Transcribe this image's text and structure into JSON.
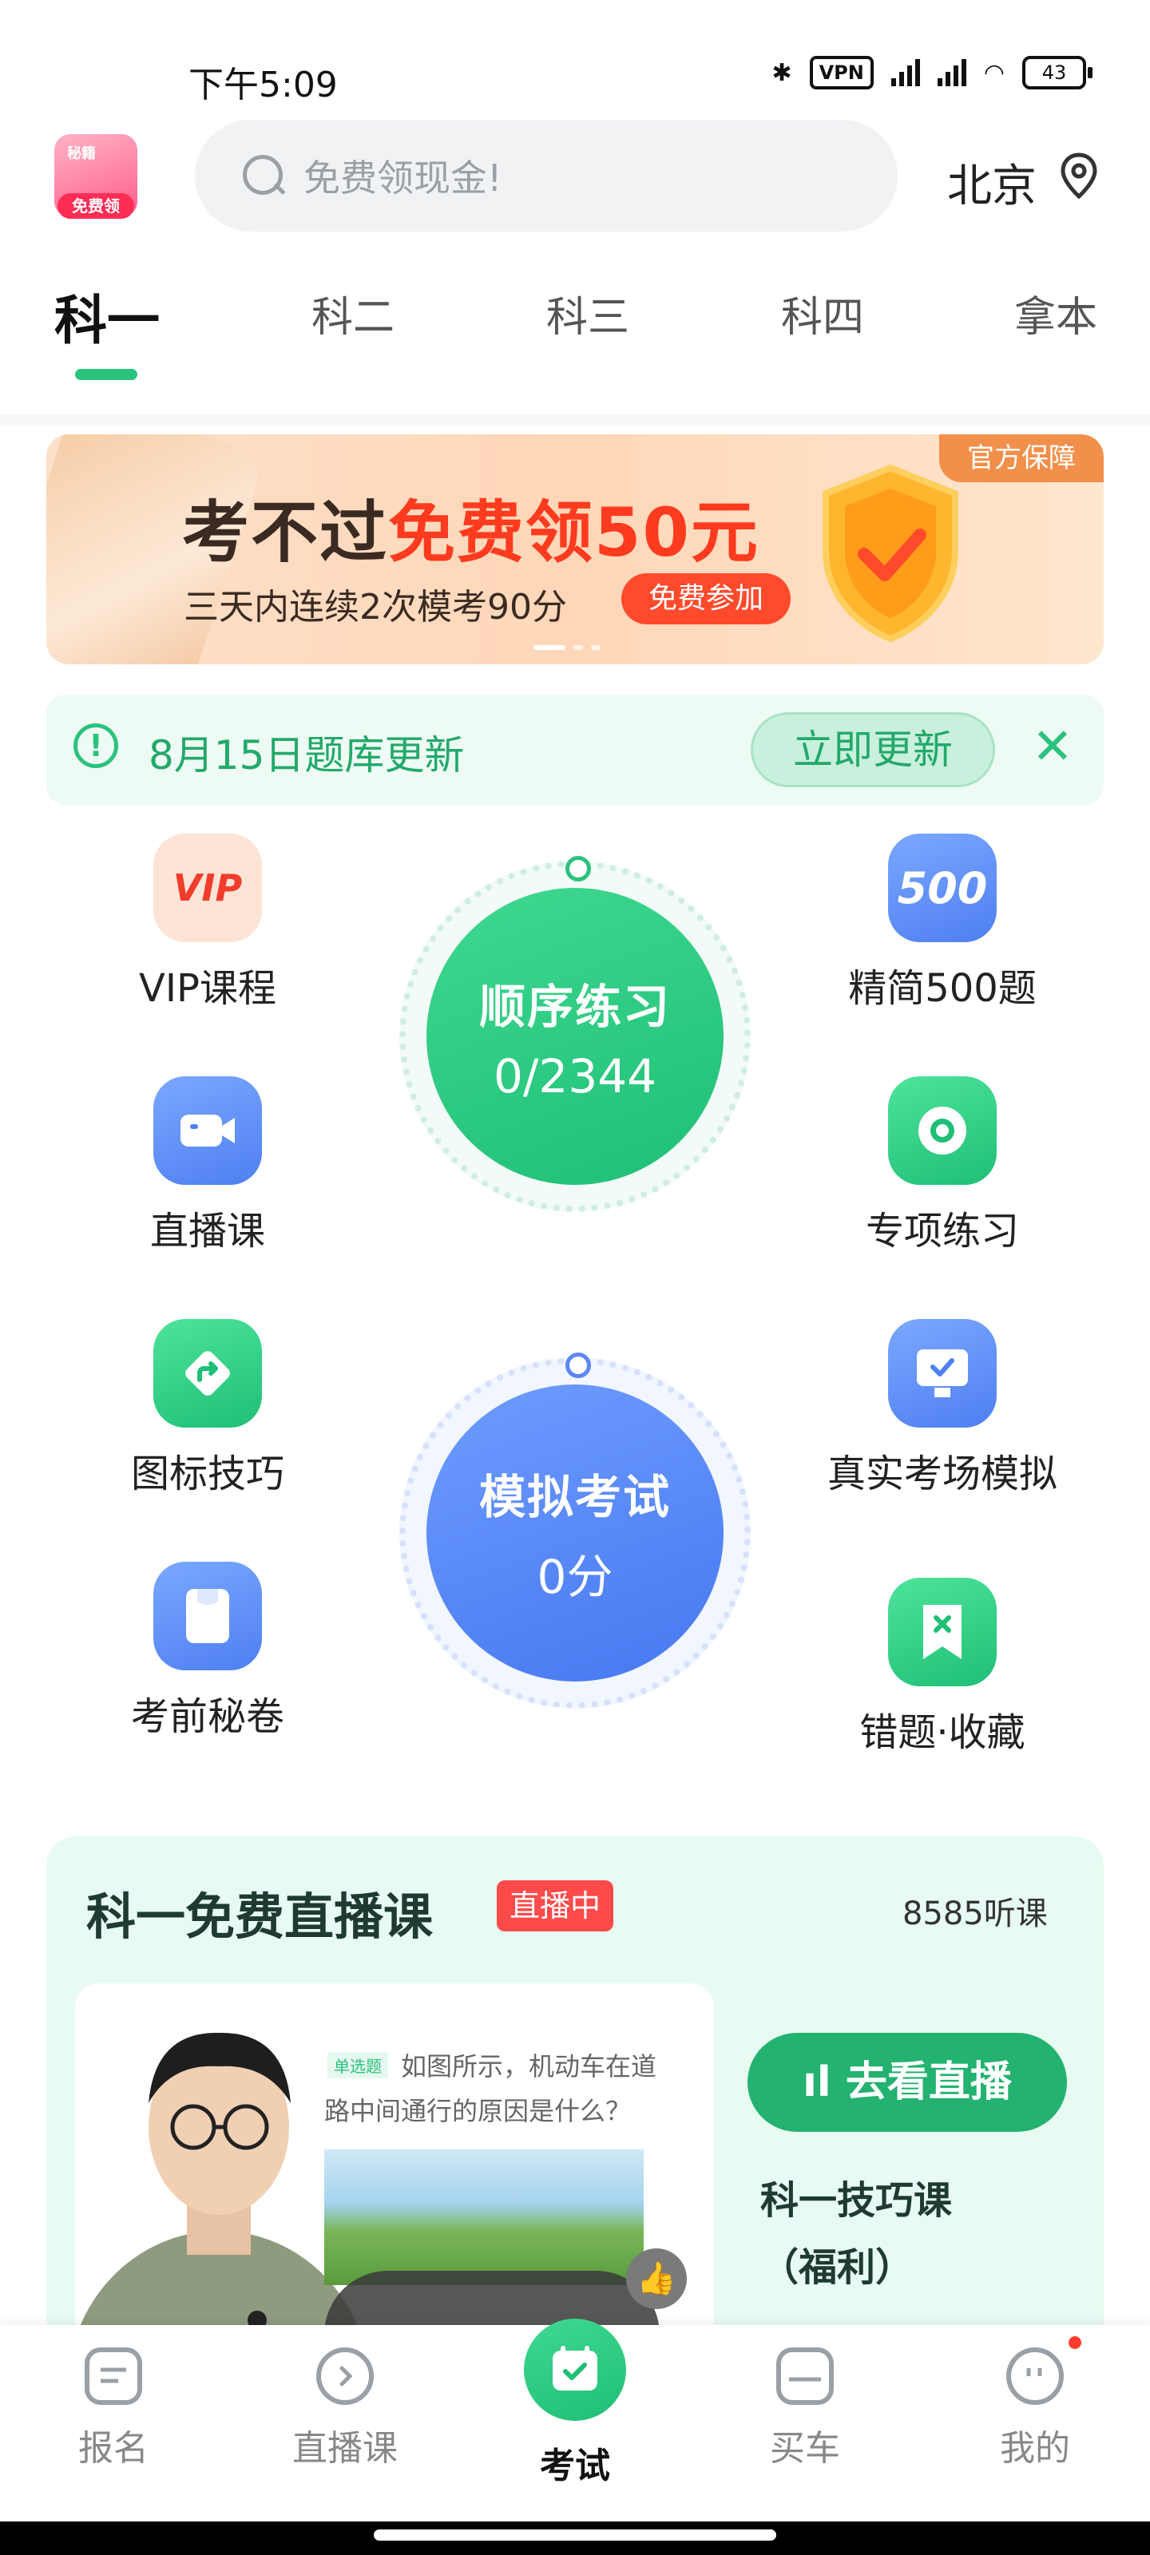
{
  "status_bar": {
    "time": "下午5:09",
    "vpn": "VPN",
    "battery": "43"
  },
  "header": {
    "logo_mini": "秘籍",
    "logo_tag": "免费领",
    "search_placeholder": "免费领现金!",
    "city": "北京"
  },
  "tabs": [
    {
      "label": "科一",
      "active": true
    },
    {
      "label": "科二"
    },
    {
      "label": "科三"
    },
    {
      "label": "科四"
    },
    {
      "label": "拿本"
    }
  ],
  "banner": {
    "title_prefix": "考不过",
    "title_highlight": "免费领50元",
    "subtitle": "三天内连续2次模考90分",
    "button": "免费参加",
    "badge": "官方保障",
    "page_indicator": {
      "current": 1,
      "total": 3
    }
  },
  "update": {
    "text": "8月15日题库更新",
    "button": "立即更新",
    "close": "✕"
  },
  "grid": {
    "vip": {
      "icon_text": "VIP",
      "label": "VIP课程"
    },
    "p500": {
      "icon_text": "500",
      "label": "精简500题"
    },
    "live": {
      "label": "直播课"
    },
    "special": {
      "label": "专项练习"
    },
    "signs": {
      "label": "图标技巧"
    },
    "real_exam": {
      "label": "真实考场模拟"
    },
    "secret": {
      "label": "考前秘卷"
    },
    "wrong": {
      "label": "错题·收藏"
    },
    "sequential": {
      "title": "顺序练习",
      "progress": "0/2344"
    },
    "mock": {
      "title": "模拟考试",
      "score": "0分"
    }
  },
  "live_card": {
    "title": "科一免费直播课",
    "tag": "直播中",
    "count": "8585听课",
    "question_tag": "单选题",
    "question": "如图所示，机动车在道路中间通行的原因是什么？",
    "button": "去看直播",
    "subtitle": "科一技巧课（福利）"
  },
  "bottom_nav": [
    {
      "label": "报名"
    },
    {
      "label": "直播课"
    },
    {
      "label": "考试",
      "active": true
    },
    {
      "label": "买车"
    },
    {
      "label": "我的"
    }
  ],
  "colors": {
    "primary_green": "#2bc27d",
    "primary_blue": "#4f7ff2",
    "banner_red": "#ff3b1f"
  }
}
